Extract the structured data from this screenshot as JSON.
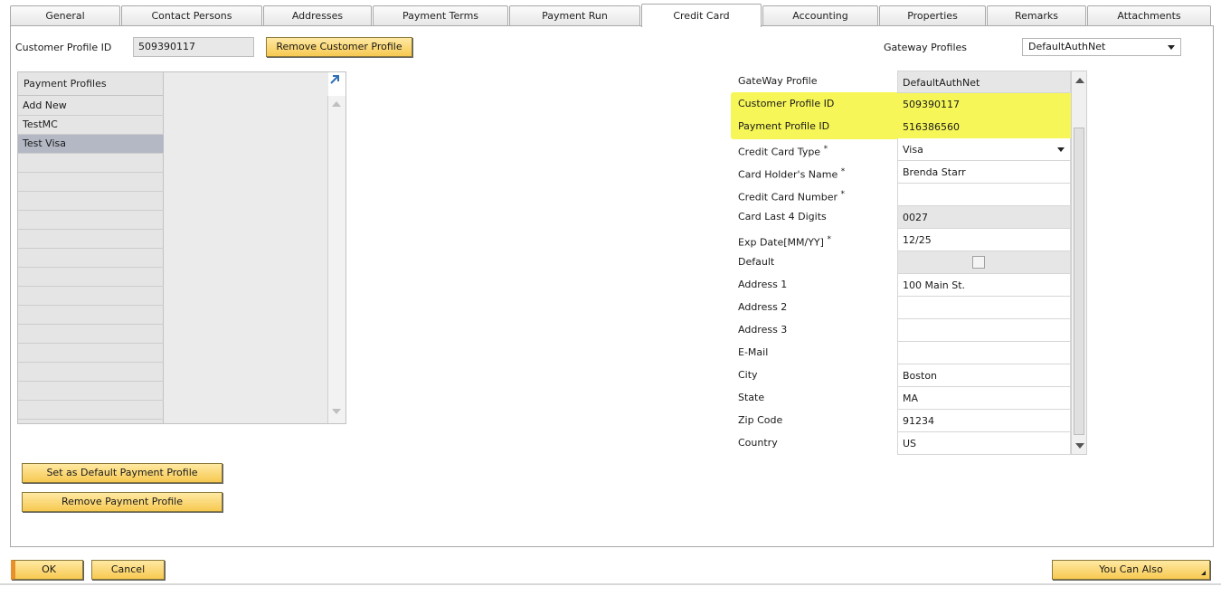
{
  "tabs": [
    {
      "label": "General"
    },
    {
      "label": "Contact Persons"
    },
    {
      "label": "Addresses"
    },
    {
      "label": "Payment Terms"
    },
    {
      "label": "Payment Run"
    },
    {
      "label": "Credit Card"
    },
    {
      "label": "Accounting"
    },
    {
      "label": "Properties"
    },
    {
      "label": "Remarks"
    },
    {
      "label": "Attachments"
    }
  ],
  "header": {
    "customer_profile_label": "Customer Profile ID",
    "customer_profile_value": "509390117",
    "remove_customer_profile_label": "Remove Customer Profile",
    "gateway_profiles_label": "Gateway Profiles",
    "gateway_profiles_value": "DefaultAuthNet"
  },
  "profiles": {
    "header": "Payment Profiles",
    "items": [
      "Add New",
      "TestMC",
      "Test Visa"
    ],
    "selected": "Test Visa"
  },
  "form": {
    "rows": [
      {
        "label": "GateWay Profile",
        "value": "DefaultAuthNet",
        "req": ""
      },
      {
        "label": "Customer Profile ID",
        "value": "509390117",
        "req": ""
      },
      {
        "label": "Payment Profile ID",
        "value": "516386560",
        "req": ""
      },
      {
        "label": "Credit Card Type",
        "value": "Visa",
        "req": "*"
      },
      {
        "label": "Card Holder's Name",
        "value": "Brenda Starr",
        "req": "*"
      },
      {
        "label": "Credit Card Number",
        "value": "",
        "req": "*"
      },
      {
        "label": "Card Last 4 Digits",
        "value": "0027",
        "req": ""
      },
      {
        "label": "Exp Date[MM/YY]",
        "value": "12/25",
        "req": "*"
      },
      {
        "label": "Default",
        "value": "",
        "req": ""
      },
      {
        "label": "Address 1",
        "value": "100 Main St.",
        "req": ""
      },
      {
        "label": "Address 2",
        "value": "",
        "req": ""
      },
      {
        "label": "Address 3",
        "value": "",
        "req": ""
      },
      {
        "label": "E-Mail",
        "value": "",
        "req": ""
      },
      {
        "label": "City",
        "value": "Boston",
        "req": ""
      },
      {
        "label": "State",
        "value": "MA",
        "req": ""
      },
      {
        "label": "Zip Code",
        "value": "91234",
        "req": ""
      },
      {
        "label": "Country",
        "value": "US",
        "req": ""
      }
    ],
    "default_checked": false
  },
  "actions": {
    "set_default_label": "Set as Default Payment Profile",
    "remove_payment_label": "Remove Payment Profile"
  },
  "footer": {
    "ok_label": "OK",
    "cancel_label": "Cancel",
    "you_can_also_label": "You Can Also"
  },
  "colors": {
    "highlight": "#f5f53b",
    "button": "#f7c951",
    "selected_row": "#b3b8c4"
  }
}
